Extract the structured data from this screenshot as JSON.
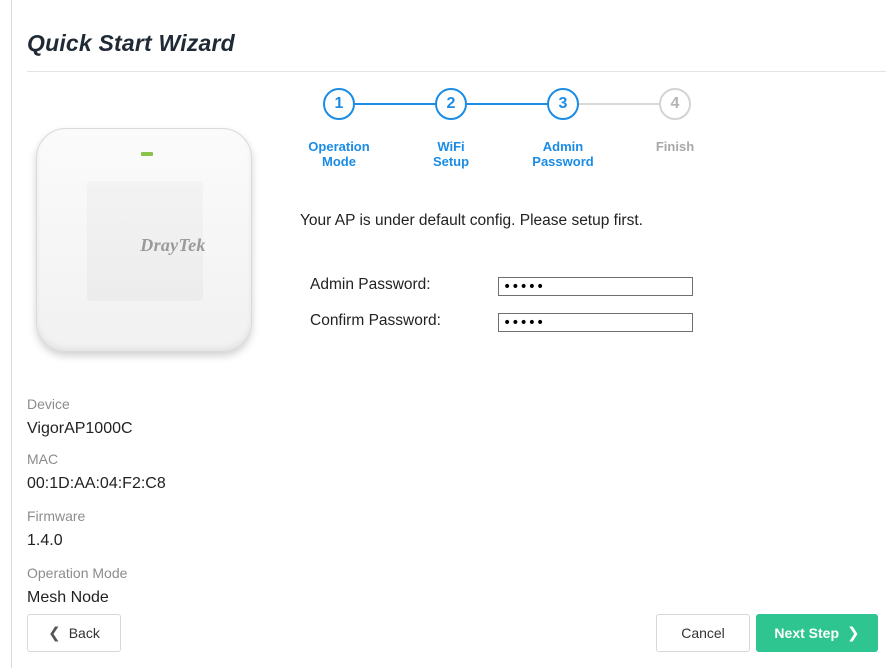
{
  "title": "Quick Start Wizard",
  "device_image": {
    "logo_text": "DrayTek"
  },
  "info": {
    "device_label": "Device",
    "device_value": "VigorAP1000C",
    "mac_label": "MAC",
    "mac_value": "00:1D:AA:04:F2:C8",
    "firmware_label": "Firmware",
    "firmware_value": "1.4.0",
    "opmode_label": "Operation Mode",
    "opmode_value": "Mesh Node"
  },
  "steps": [
    {
      "number": "1",
      "line1": "Operation",
      "line2": "Mode",
      "state": "active"
    },
    {
      "number": "2",
      "line1": "WiFi",
      "line2": "Setup",
      "state": "active"
    },
    {
      "number": "3",
      "line1": "Admin",
      "line2": "Password",
      "state": "current"
    },
    {
      "number": "4",
      "line1": "Finish",
      "line2": "",
      "state": "inactive"
    }
  ],
  "colors": {
    "accent": "#1a8ce6",
    "inactive": "#d4d4d4",
    "next_button": "#2fc590"
  },
  "notice": "Your AP is under default config. Please setup first.",
  "form": {
    "admin_password_label": "Admin Password:",
    "admin_password_value": "•••••",
    "confirm_password_label": "Confirm Password:",
    "confirm_password_value": "•••••"
  },
  "buttons": {
    "back_label": "Back",
    "cancel_label": "Cancel",
    "next_label": "Next Step"
  },
  "icons": {
    "back": "chevron-left-icon",
    "next": "chevron-right-icon"
  }
}
